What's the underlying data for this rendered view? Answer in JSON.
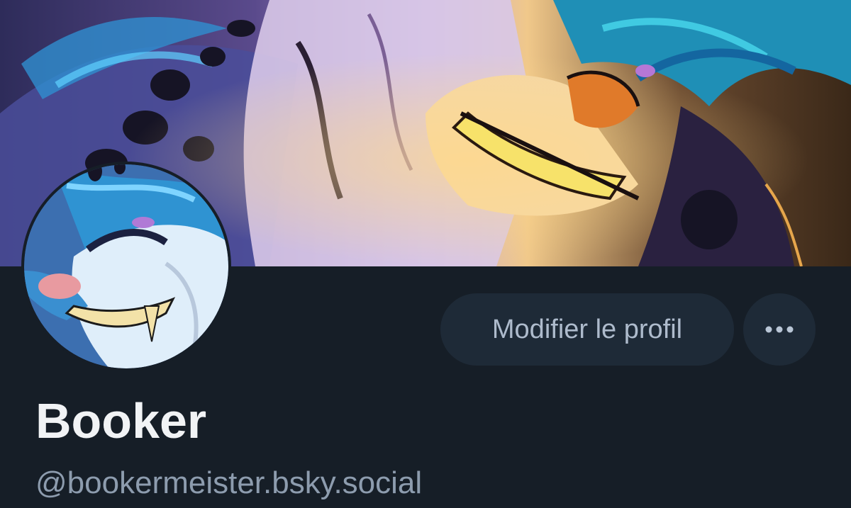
{
  "profile": {
    "display_name": "Booker",
    "handle": "@bookermeister.bsky.social",
    "edit_button_label": "Modifier le profil",
    "more_button_icon": "ellipsis-horizontal-icon"
  },
  "images": {
    "banner": "banner-illustration",
    "avatar": "avatar-illustration"
  },
  "colors": {
    "background": "#161e27",
    "button_bg": "#1e2a37",
    "button_text": "#aebbcc",
    "name_text": "#f1f3f5",
    "handle_text": "#8d9cae"
  }
}
